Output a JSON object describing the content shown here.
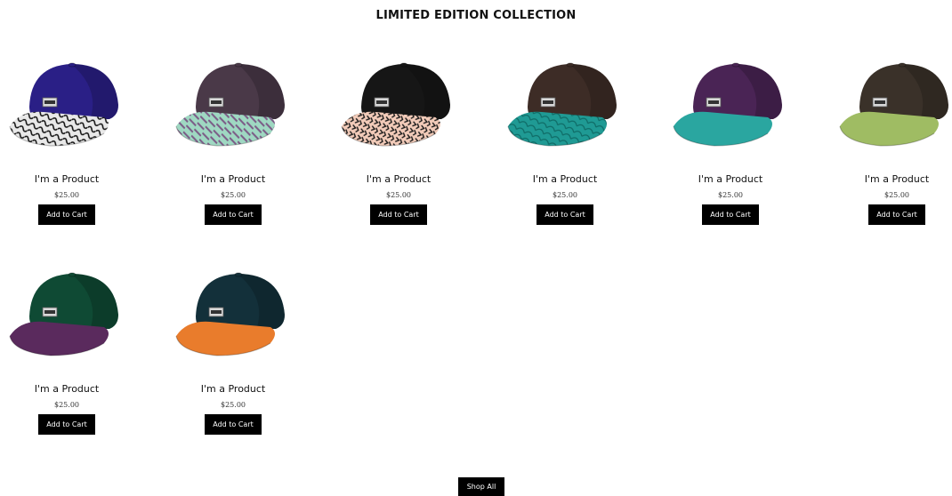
{
  "section": {
    "title": "LIMITED EDITION COLLECTION"
  },
  "products": [
    {
      "name": "I'm a Product",
      "price": "$25.00",
      "cta": "Add to Cart",
      "crown_color": "#2a1f86",
      "brim_color": "#e8e8e8",
      "brim_pattern": "swirl-black"
    },
    {
      "name": "I'm a Product",
      "price": "$25.00",
      "cta": "Add to Cart",
      "crown_color": "#4a3948",
      "brim_color": "#9fd8c2",
      "brim_pattern": "purple-mint"
    },
    {
      "name": "I'm a Product",
      "price": "$25.00",
      "cta": "Add to Cart",
      "crown_color": "#161616",
      "brim_color": "#f2cbb9",
      "brim_pattern": "animal-print"
    },
    {
      "name": "I'm a Product",
      "price": "$25.00",
      "cta": "Add to Cart",
      "crown_color": "#3d2c26",
      "brim_color": "#1f9a94",
      "brim_pattern": "palm-leaves"
    },
    {
      "name": "I'm a Product",
      "price": "$25.00",
      "cta": "Add to Cart",
      "crown_color": "#4a2455",
      "brim_color": "#2aa6a0",
      "brim_pattern": "solid"
    },
    {
      "name": "I'm a Product",
      "price": "$25.00",
      "cta": "Add to Cart",
      "crown_color": "#3a3129",
      "brim_color": "#9fbc63",
      "brim_pattern": "solid"
    },
    {
      "name": "I'm a Product",
      "price": "$25.00",
      "cta": "Add to Cart",
      "crown_color": "#0f4a34",
      "brim_color": "#5a2a5d",
      "brim_pattern": "solid"
    },
    {
      "name": "I'm a Product",
      "price": "$25.00",
      "cta": "Add to Cart",
      "crown_color": "#13303a",
      "brim_color": "#e97c2c",
      "brim_pattern": "solid"
    }
  ],
  "footer": {
    "shop_all_label": "Shop All"
  }
}
